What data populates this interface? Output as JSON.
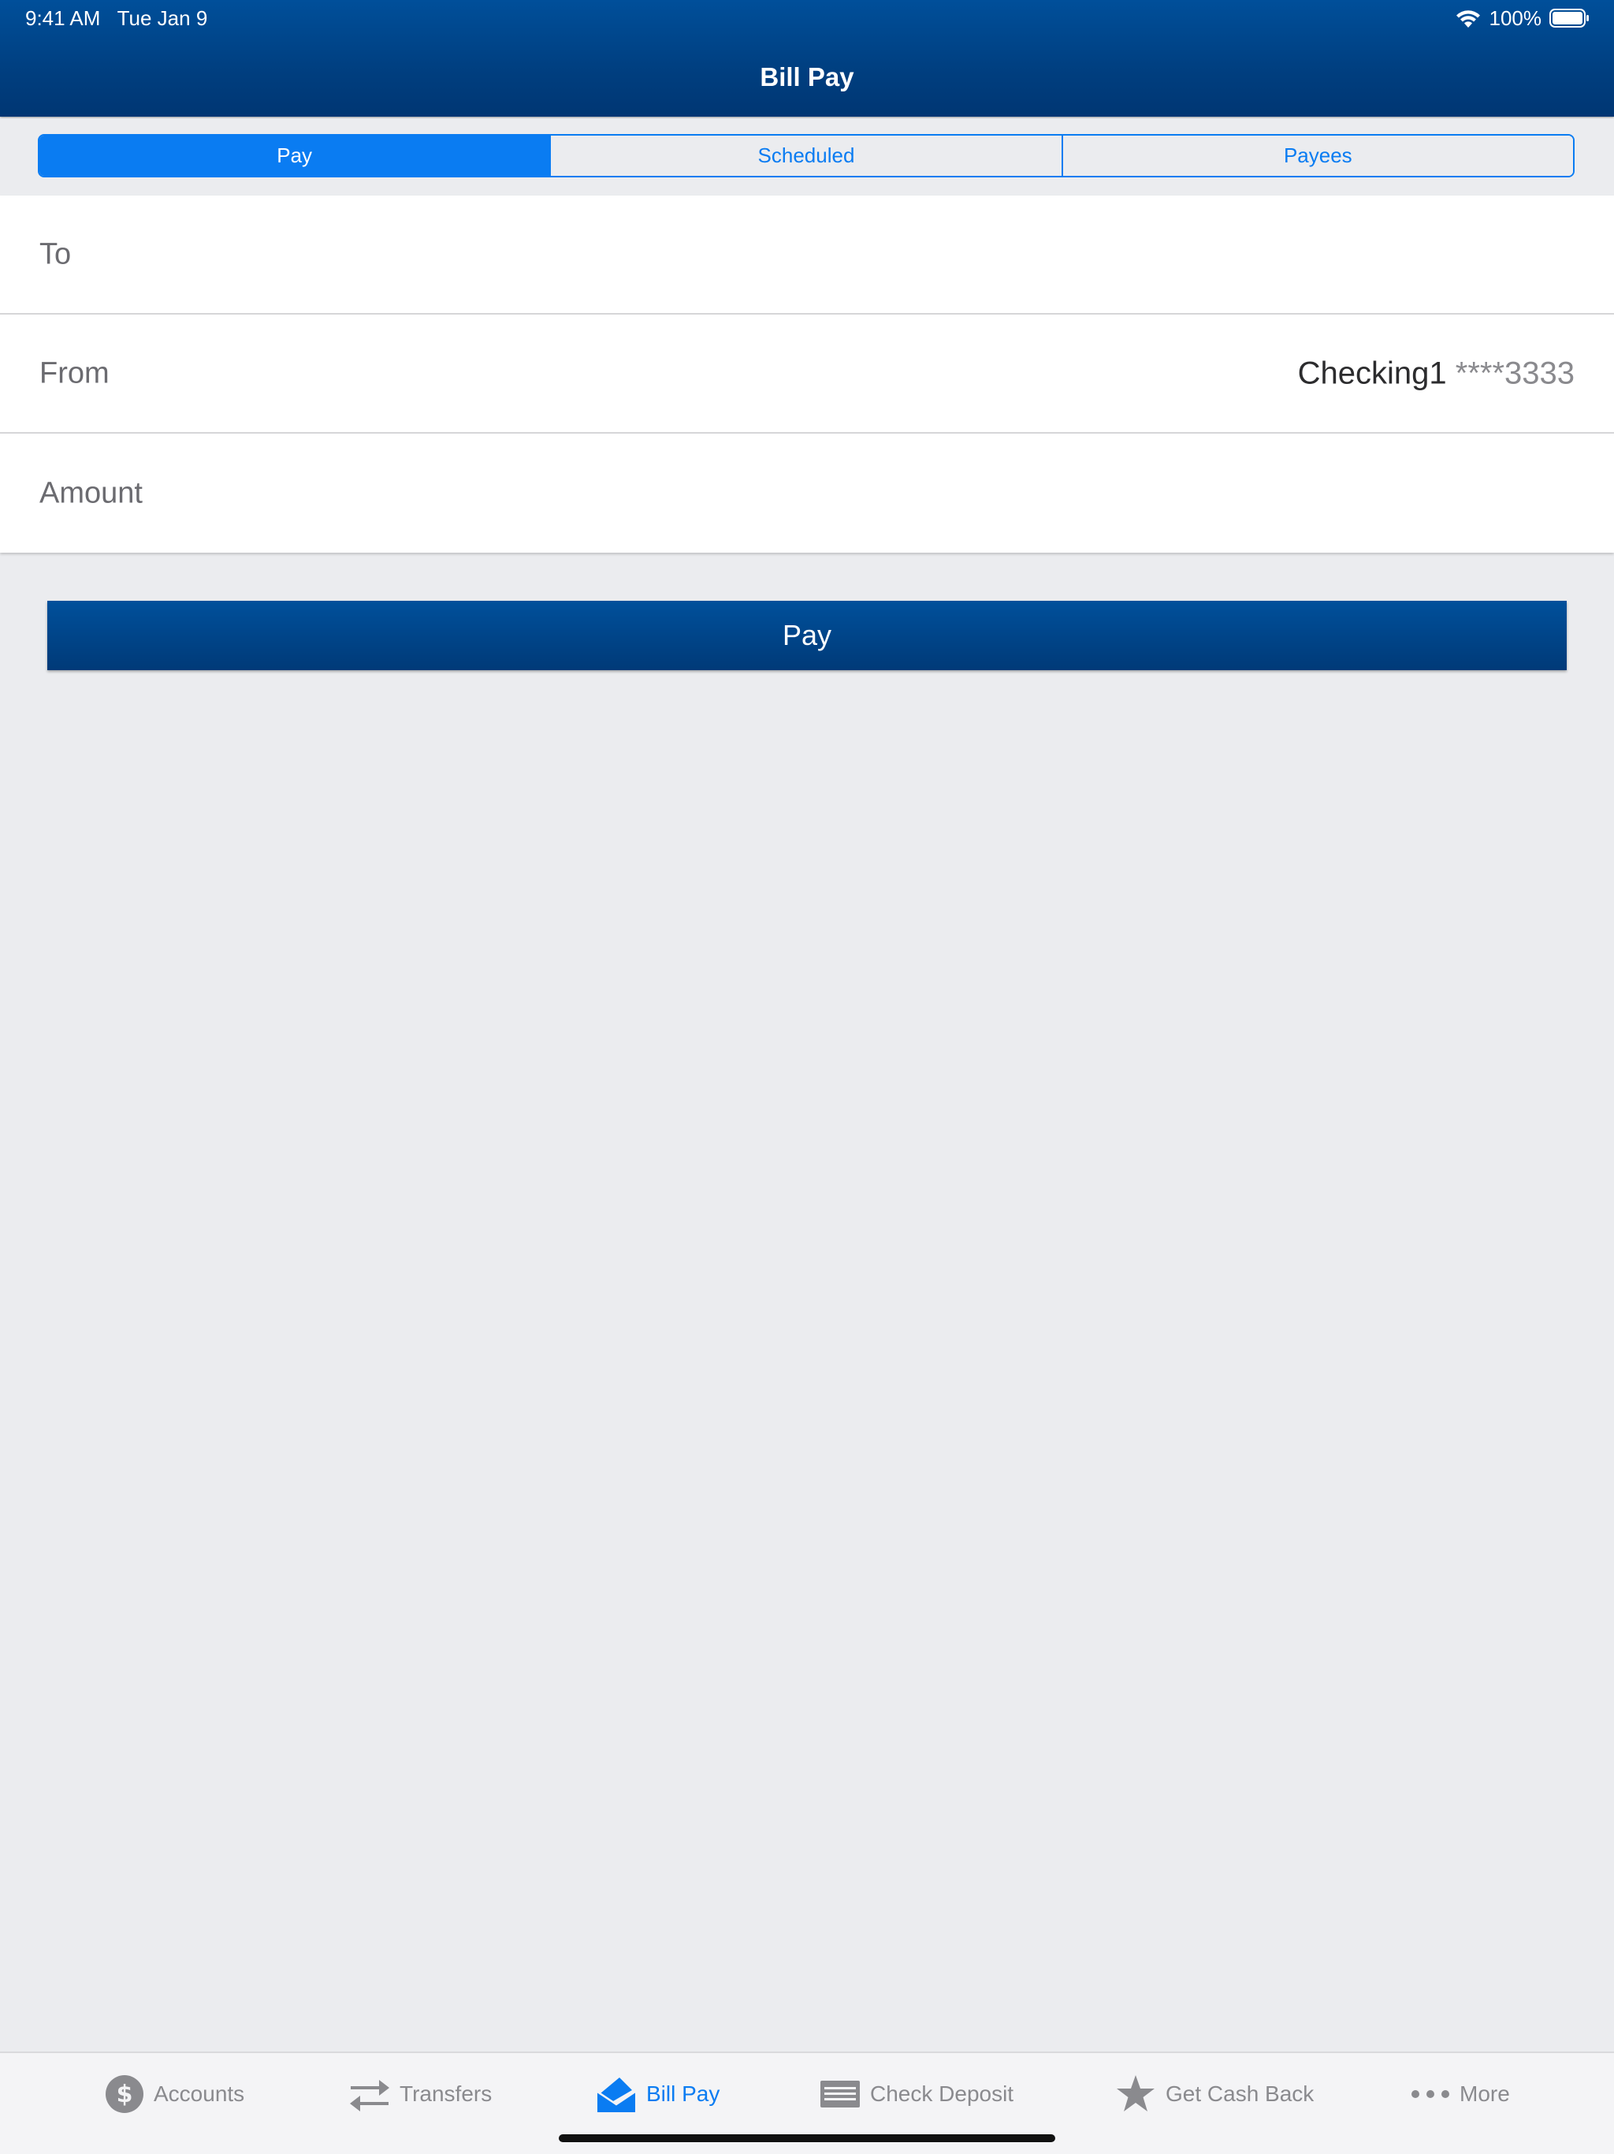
{
  "status_bar": {
    "time": "9:41 AM",
    "date": "Tue Jan 9",
    "battery": "100%"
  },
  "header": {
    "title": "Bill Pay"
  },
  "segments": [
    {
      "label": "Pay",
      "active": true
    },
    {
      "label": "Scheduled",
      "active": false
    },
    {
      "label": "Payees",
      "active": false
    }
  ],
  "form": {
    "to_label": "To",
    "from_label": "From",
    "from_account_name": "Checking1",
    "from_account_mask": "****3333",
    "amount_label": "Amount"
  },
  "pay_button_label": "Pay",
  "tabs": [
    {
      "label": "Accounts",
      "icon": "dollar-circle-icon",
      "active": false
    },
    {
      "label": "Transfers",
      "icon": "transfer-arrows-icon",
      "active": false
    },
    {
      "label": "Bill Pay",
      "icon": "envelope-bill-icon",
      "active": true
    },
    {
      "label": "Check Deposit",
      "icon": "check-icon",
      "active": false
    },
    {
      "label": "Get Cash Back",
      "icon": "star-icon",
      "active": false
    },
    {
      "label": "More",
      "icon": "ellipsis-icon",
      "active": false
    }
  ],
  "colors": {
    "header": "#004a93",
    "accent": "#0a7cf2",
    "background": "#ebecef",
    "inactive_tab": "#8a8a8e"
  }
}
